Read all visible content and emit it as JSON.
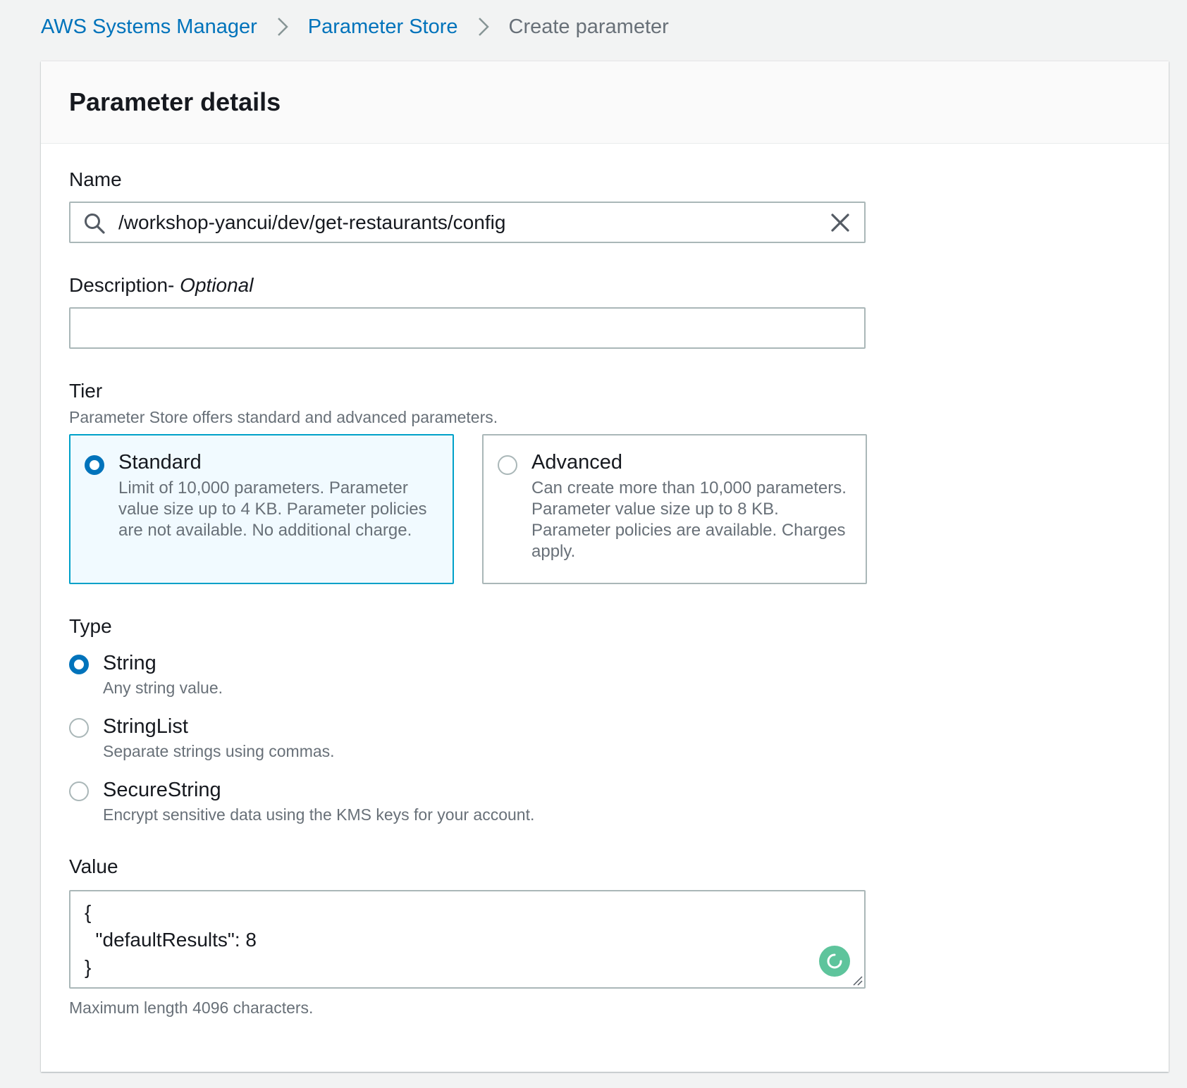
{
  "breadcrumb": {
    "items": [
      {
        "label": "AWS Systems Manager"
      },
      {
        "label": "Parameter Store"
      }
    ],
    "current": "Create parameter"
  },
  "panel": {
    "title": "Parameter details"
  },
  "name_field": {
    "label": "Name",
    "value": "/workshop-yancui/dev/get-restaurants/config"
  },
  "description_field": {
    "label": "Description-",
    "optional_label": "Optional",
    "value": ""
  },
  "tier": {
    "label": "Tier",
    "description": "Parameter Store offers standard and advanced parameters.",
    "selected": "Standard",
    "options": [
      {
        "title": "Standard",
        "description": "Limit of 10,000 parameters. Parameter value size up to 4 KB. Parameter policies are not available. No additional charge."
      },
      {
        "title": "Advanced",
        "description": "Can create more than 10,000 parameters. Parameter value size up to 8 KB. Parameter policies are available. Charges apply."
      }
    ]
  },
  "type": {
    "label": "Type",
    "selected": "String",
    "options": [
      {
        "title": "String",
        "description": "Any string value."
      },
      {
        "title": "StringList",
        "description": "Separate strings using commas."
      },
      {
        "title": "SecureString",
        "description": "Encrypt sensitive data using the KMS keys for your account."
      }
    ]
  },
  "value_field": {
    "label": "Value",
    "value": "{\n  \"defaultResults\": 8\n}",
    "constraint": "Maximum length 4096 characters."
  },
  "icons": {
    "breadcrumb_separator": "chevron-right-icon",
    "name_prefix": "search-icon",
    "name_clear": "close-icon",
    "value_assistant": "grammarly-icon"
  },
  "colors": {
    "link": "#0073bb",
    "selected_radio": "#0073bb",
    "selected_card_bg": "#f1faff",
    "selected_card_border": "#00a1c9",
    "assistant_icon": "#5ec49c"
  }
}
